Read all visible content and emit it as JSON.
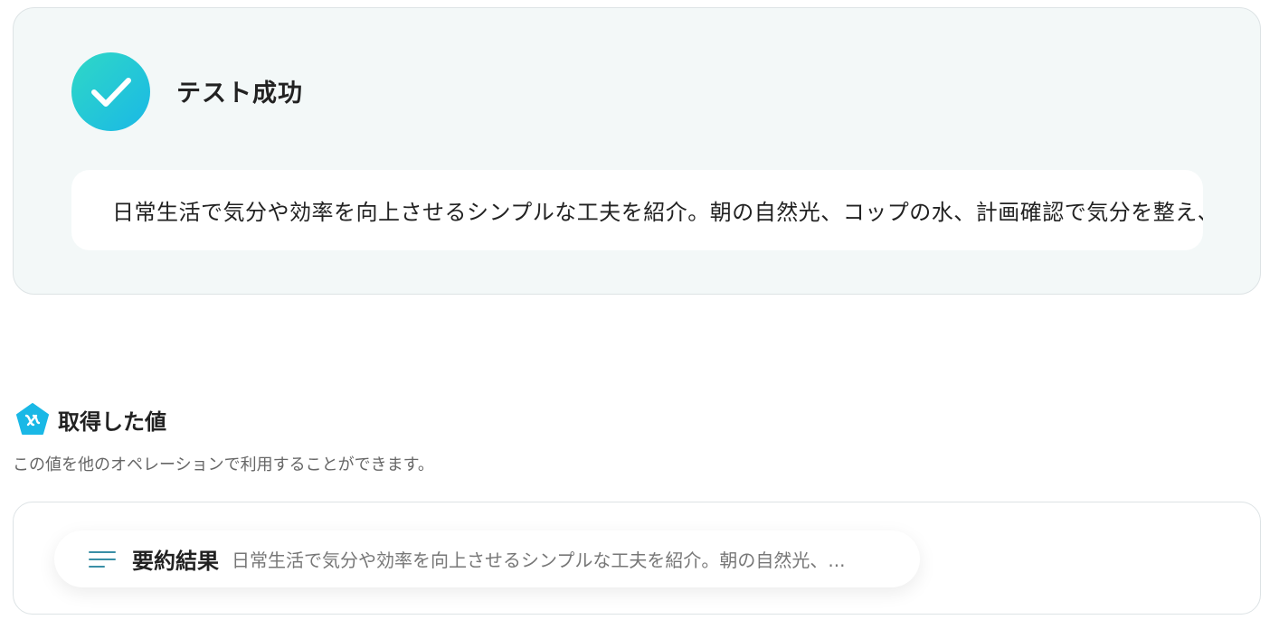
{
  "test_result": {
    "status_icon": "check-icon",
    "title": "テスト成功",
    "output_text": "日常生活で気分や効率を向上させるシンプルな工夫を紹介。朝の自然光、コップの水、計画確認で気分を整え、"
  },
  "obtained_values": {
    "icon": "variable-pentagon-icon",
    "title": "取得した値",
    "description": "この値を他のオペレーションで利用することができます。",
    "items": [
      {
        "icon": "text-lines-icon",
        "label": "要約結果",
        "value": "日常生活で気分や効率を向上させるシンプルな工夫を紹介。朝の自然光、..."
      }
    ]
  },
  "colors": {
    "success_gradient_start": "#2fd8c6",
    "success_gradient_end": "#1ab8e6",
    "panel_background": "#f3f8f8",
    "pentagon_icon": "#1ab8e6"
  }
}
